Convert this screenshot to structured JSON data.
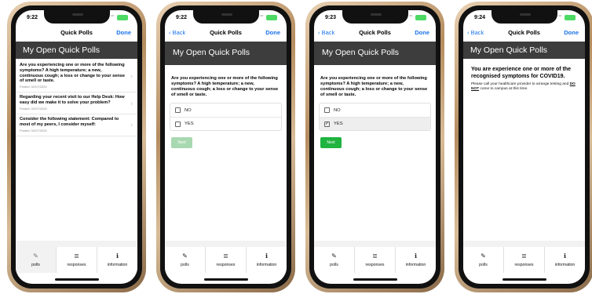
{
  "tabs": [
    {
      "icon": "✎",
      "label": "polls"
    },
    {
      "icon": "≣",
      "label": "responses"
    },
    {
      "icon": "ℹ",
      "label": "information"
    }
  ],
  "screen1": {
    "time": "9:22",
    "title": "Quick Polls",
    "done": "Done",
    "header": "My Open Quick Polls",
    "polls": [
      {
        "question": "Are you experiencing one or more of the following symptoms? A high temperature; a new, continuous cough; a loss or change to your sense of smell or taste.",
        "date": "Posted: 02/07/2020"
      },
      {
        "question": "Regarding your recent visit to our Help Desk: How easy did we make it to solve your problem?",
        "date": "Posted: 02/07/2020"
      },
      {
        "question": "Consider the following statement: Compared to most of my peers, I consider myself:",
        "date": "Posted: 02/07/2020"
      }
    ]
  },
  "screen2": {
    "time": "9:22",
    "back": "Back",
    "title": "Quick Polls",
    "done": "Done",
    "header": "My Open Quick Polls",
    "question": "Are you experiencing one or more of the following symptoms? A high temperature; a new, continuous cough; a loss or change to your sense of smell or taste.",
    "options": [
      "NO",
      "YES"
    ],
    "next": "Next"
  },
  "screen3": {
    "time": "9:23",
    "back": "Back",
    "title": "Quick Polls",
    "done": "Done",
    "header": "My Open Quick Polls",
    "question": "Are you experiencing one or more of the following symptoms? A high temperature; a new, continuous cough; a loss or change to your sense of smell or taste.",
    "options": [
      "NO",
      "YES"
    ],
    "selected": "YES",
    "next": "Next"
  },
  "screen4": {
    "time": "9:24",
    "back": "Back",
    "title": "Quick Polls",
    "done": "Done",
    "header": "My Open Quick Polls",
    "result_title": "You are experience one or more of the recognised symptoms for COVID19.",
    "result_body_before": "Please call your healthcare provider to arrange testing and ",
    "result_body_emph": "DO NOT",
    "result_body_after": " come to campus at this time."
  }
}
